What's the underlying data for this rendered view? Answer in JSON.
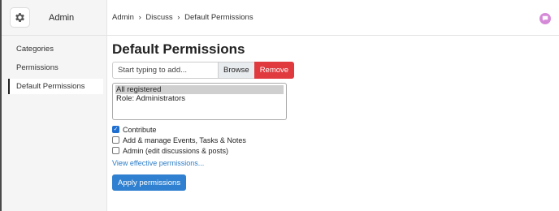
{
  "app": {
    "title": "Admin"
  },
  "sidebar": {
    "items": [
      {
        "label": "Categories",
        "active": false
      },
      {
        "label": "Permissions",
        "active": false
      },
      {
        "label": "Default Permissions",
        "active": true
      }
    ]
  },
  "breadcrumb": [
    "Admin",
    "›",
    "Discuss",
    "›",
    "Default Permissions"
  ],
  "page": {
    "title": "Default Permissions",
    "search_placeholder": "Start typing to add...",
    "browse_label": "Browse",
    "remove_label": "Remove",
    "list_options": [
      {
        "label": "All registered",
        "selected": true
      },
      {
        "label": "Role: Administrators",
        "selected": false
      }
    ],
    "permissions": [
      {
        "label": "Contribute",
        "checked": true
      },
      {
        "label": "Add & manage Events, Tasks & Notes",
        "checked": false
      },
      {
        "label": "Admin (edit discussions & posts)",
        "checked": false
      }
    ],
    "view_link": "View effective permissions...",
    "apply_label": "Apply permissions"
  },
  "colors": {
    "accent": "#2f80d0",
    "danger": "#e0393e",
    "link": "#2a7cc7",
    "chat": "#d58ad8"
  },
  "icons": {
    "brand": "gear-icon",
    "chat": "chat-bubble-icon"
  }
}
